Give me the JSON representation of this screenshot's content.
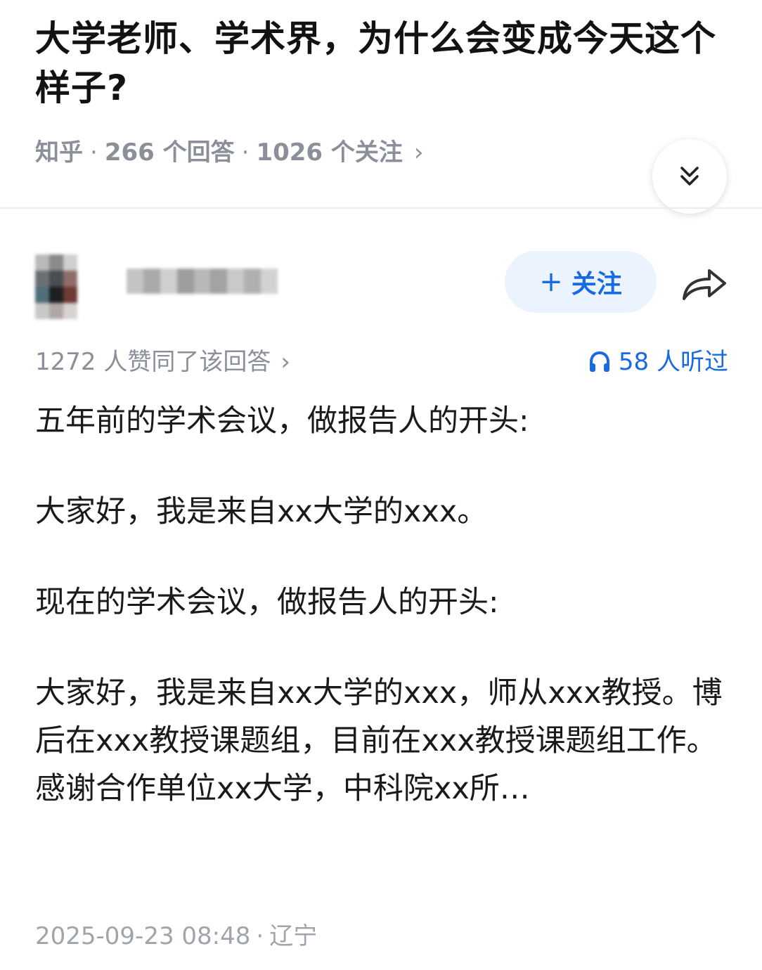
{
  "question": {
    "title": "大学老师、学术界，为什么会变成今天这个样子?",
    "source": "知乎",
    "separator": "·",
    "answers_count": "266 个回答",
    "followers_count": "1026 个关注",
    "chevron": "›"
  },
  "author": {
    "follow_plus": "+",
    "follow_label": "关注"
  },
  "stats": {
    "likes": "1272 人赞同了该回答",
    "likes_chevron": "›",
    "listened": "58 人听过"
  },
  "answer": {
    "paragraphs": [
      "五年前的学术会议，做报告人的开头:",
      "大家好，我是来自xx大学的xxx。",
      "现在的学术会议，做报告人的开头:",
      "大家好，我是来自xx大学的xxx，师从xxx教授。博后在xxx教授课题组，目前在xxx教授课题组工作。感谢合作单位xx大学，中科院xx所…"
    ]
  },
  "footer": {
    "date": "2025-09-23 08:48",
    "separator": "·",
    "location": "辽宁"
  },
  "colors": {
    "accent_blue": "#1769e6",
    "follow_bg": "#ebf3fe",
    "meta_gray": "#8a8f99"
  },
  "icons": [
    "double-chevron-down-icon",
    "share-arrow-icon",
    "headphones-icon"
  ]
}
